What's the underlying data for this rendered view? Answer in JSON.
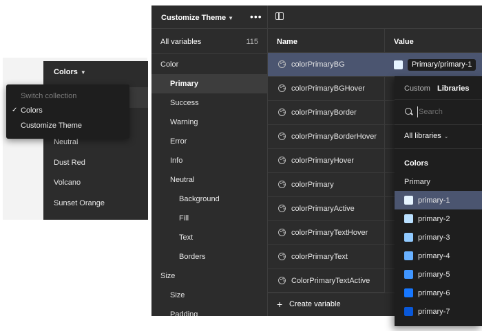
{
  "collections_panel": {
    "title": "Colors",
    "items": [
      "Neutral",
      "Dust Red",
      "Volcano",
      "Sunset Orange"
    ]
  },
  "collection_menu": {
    "header": "Switch collection",
    "items": [
      {
        "label": "Colors",
        "checked": true
      },
      {
        "label": "Customize Theme",
        "checked": false
      }
    ]
  },
  "sidebar": {
    "title": "Customize Theme",
    "more_icon": "ellipsis-icon",
    "all_variables_label": "All variables",
    "all_variables_count": "115",
    "tree": [
      {
        "label": "Color",
        "level": 0
      },
      {
        "label": "Primary",
        "level": 1,
        "selected": true
      },
      {
        "label": "Success",
        "level": 1
      },
      {
        "label": "Warning",
        "level": 1
      },
      {
        "label": "Error",
        "level": 1
      },
      {
        "label": "Info",
        "level": 1
      },
      {
        "label": "Neutral",
        "level": 1
      },
      {
        "label": "Background",
        "level": 2
      },
      {
        "label": "Fill",
        "level": 2
      },
      {
        "label": "Text",
        "level": 2
      },
      {
        "label": "Borders",
        "level": 2
      },
      {
        "label": "Size",
        "level": 0
      },
      {
        "label": "Size",
        "level": 1
      },
      {
        "label": "Padding",
        "level": 1
      }
    ]
  },
  "table": {
    "toggle_icon": "sidebar-toggle-icon",
    "columns": {
      "name": "Name",
      "value": "Value"
    },
    "variables": [
      {
        "name": "colorPrimaryBG",
        "selected": true
      },
      {
        "name": "colorPrimaryBGHover"
      },
      {
        "name": "colorPrimaryBorder"
      },
      {
        "name": "colorPrimaryBorderHover"
      },
      {
        "name": "colorPrimaryHover"
      },
      {
        "name": "colorPrimary"
      },
      {
        "name": "colorPrimaryActive"
      },
      {
        "name": "colorPrimaryTextHover"
      },
      {
        "name": "colorPrimaryText"
      },
      {
        "name": "ColorPrimaryTextActive"
      }
    ],
    "selected_value": {
      "swatch": "#e6f4ff",
      "alias": "Primary/primary-1"
    },
    "create_label": "Create variable"
  },
  "picker": {
    "tabs": [
      {
        "label": "Custom",
        "active": false
      },
      {
        "label": "Libraries",
        "active": true
      }
    ],
    "search_placeholder": "Search",
    "libraries_filter": "All libraries",
    "section": "Colors",
    "group": "Primary",
    "items": [
      {
        "label": "primary-1",
        "color": "#e6f4ff",
        "selected": true
      },
      {
        "label": "primary-2",
        "color": "#bae0ff"
      },
      {
        "label": "primary-3",
        "color": "#91caff"
      },
      {
        "label": "primary-4",
        "color": "#69b1ff"
      },
      {
        "label": "primary-5",
        "color": "#4096ff"
      },
      {
        "label": "primary-6",
        "color": "#1677ff"
      },
      {
        "label": "primary-7",
        "color": "#0958d9"
      }
    ]
  }
}
